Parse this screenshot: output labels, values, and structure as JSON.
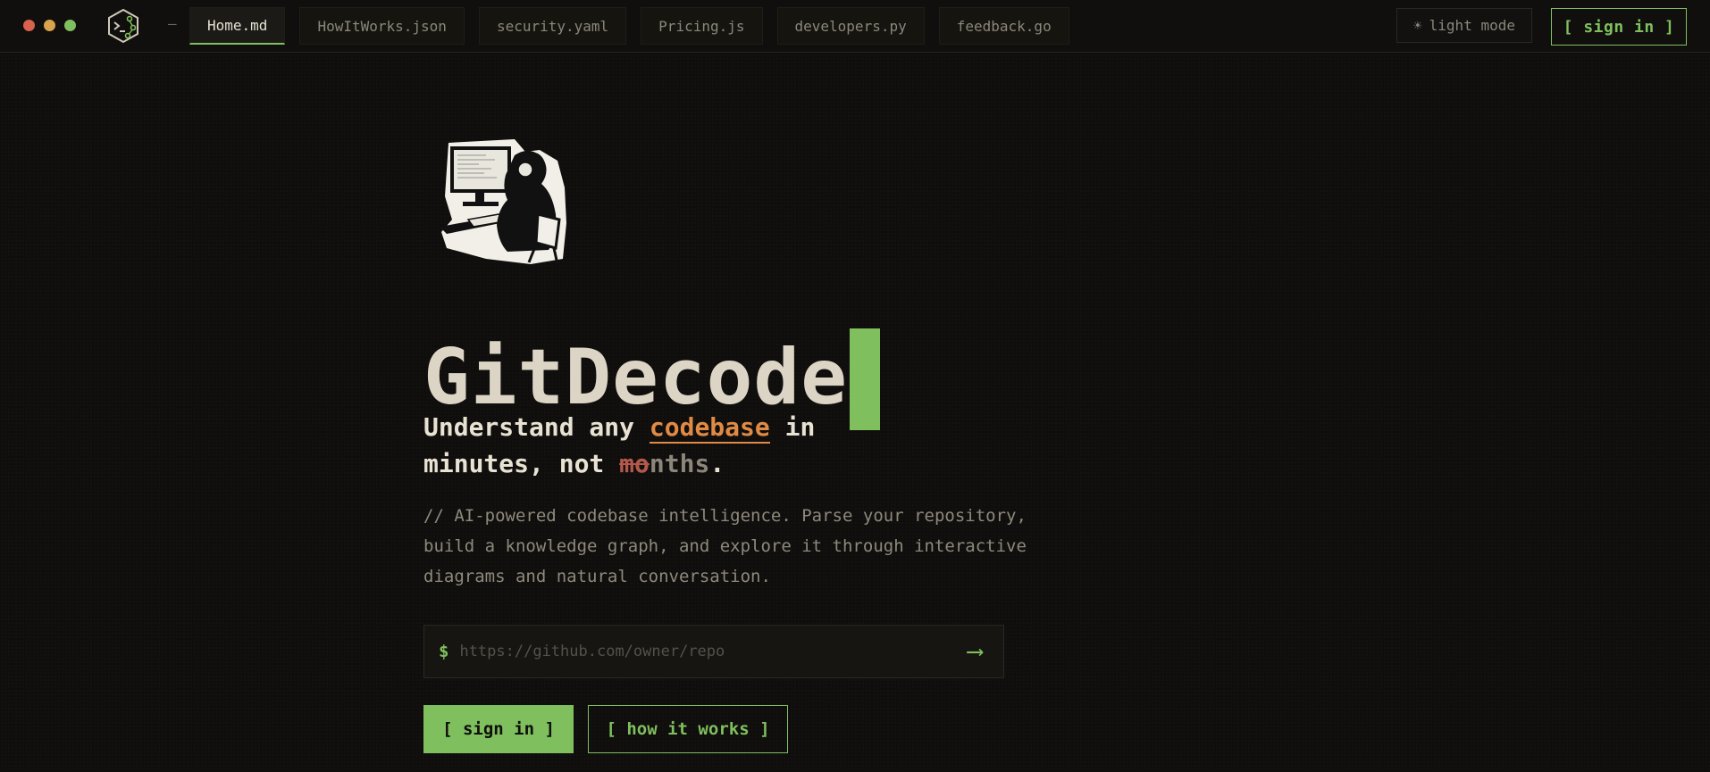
{
  "window": {
    "controls": [
      "close",
      "minimize",
      "maximize"
    ],
    "logo_icon": "cube-terminal-icon"
  },
  "tabs": [
    {
      "label": "Home.md",
      "active": true
    },
    {
      "label": "HowItWorks.json",
      "active": false
    },
    {
      "label": "security.yaml",
      "active": false
    },
    {
      "label": "Pricing.js",
      "active": false
    },
    {
      "label": "developers.py",
      "active": false
    },
    {
      "label": "feedback.go",
      "active": false
    }
  ],
  "header": {
    "theme_icon": "☀",
    "theme_label": "light mode",
    "signin_label": "[ sign in ]"
  },
  "hero": {
    "illustration": "developer-at-computer-illustration",
    "title": "GitDecode",
    "tagline": {
      "part1": "Understand any ",
      "highlight": "codebase",
      "part2": " in",
      "line2_start": "minutes, not ",
      "strike": "mo",
      "faded": "nths",
      "end": "."
    },
    "description": "// AI-powered codebase intelligence. Parse your repository, build a knowledge graph, and explore it through interactive diagrams and natural conversation.",
    "input": {
      "prompt": "$",
      "placeholder": "https://github.com/owner/repo",
      "value": "",
      "submit_icon": "⟶"
    },
    "primary_button": "[ sign in ]",
    "secondary_button": "[ how it works ]"
  },
  "colors": {
    "accent": "#7fbf5e",
    "highlight": "#e08a45",
    "background": "#0f0e0c"
  }
}
